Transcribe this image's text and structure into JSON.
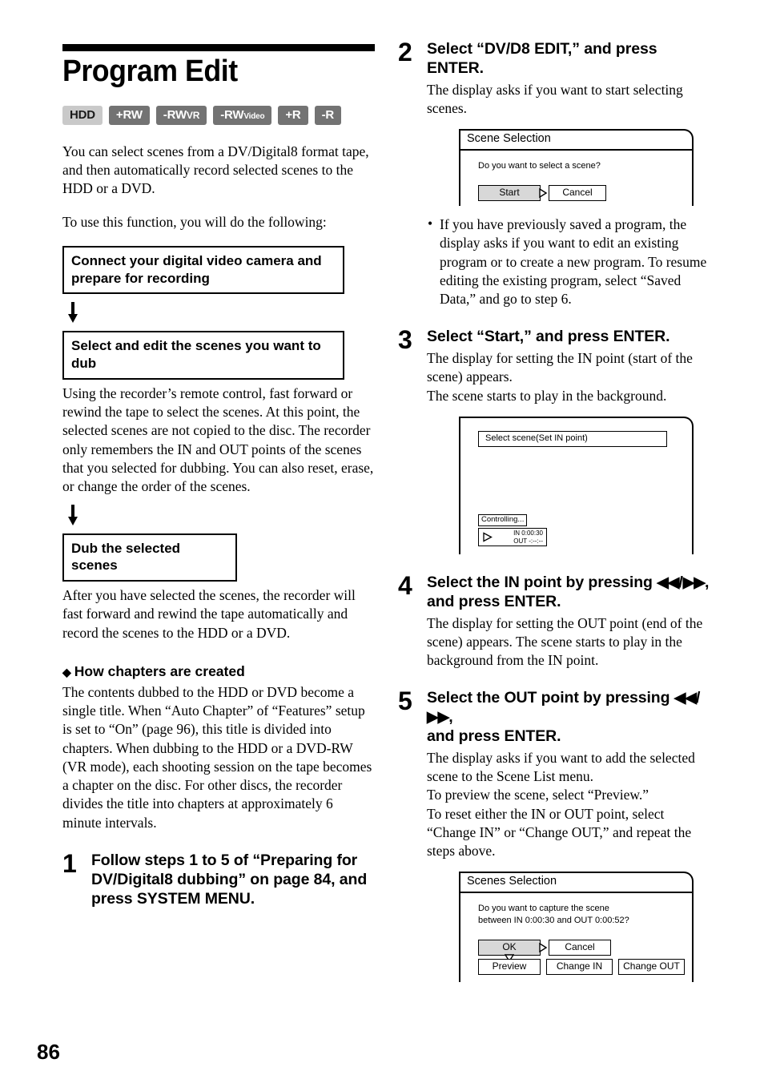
{
  "page": {
    "number": "86"
  },
  "heading": {
    "title": "Program Edit"
  },
  "badges": [
    {
      "label": "HDD",
      "style": "light"
    },
    {
      "label": "+RW",
      "style": "dark"
    },
    {
      "label": "-RWVR",
      "style": "dark"
    },
    {
      "label": "-RWVideo",
      "style": "dark"
    },
    {
      "label": "+R",
      "style": "dark"
    },
    {
      "label": "-R",
      "style": "dark"
    }
  ],
  "intro": {
    "para1": "You can select scenes from a DV/Digital8 format tape, and then automatically record selected scenes to the HDD or a DVD.",
    "para2": "To use this function, you will do the following:"
  },
  "flow": {
    "box1": "Connect your digital video camera and prepare for recording",
    "box2": "Select and edit the scenes you want to dub",
    "box2_text": "Using the recorder’s remote control, fast forward or rewind the tape to select the scenes. At this point, the selected scenes are not copied to the disc. The recorder only remembers the IN and OUT points of the scenes that you selected for dubbing. You can also reset, erase, or change the order of the scenes.",
    "box3": "Dub the selected scenes",
    "box3_text": "After you have selected the scenes, the recorder will fast forward and rewind the tape automatically and record the scenes to the HDD or a DVD.",
    "arrow_icon": "down-arrow-icon"
  },
  "chapters": {
    "bullet_icon": "diamond-bullet-icon",
    "heading": "How chapters are created",
    "text": "The contents dubbed to the HDD or DVD become a single title. When “Auto Chapter” of “Features” setup is set to “On” (page 96), this title is divided into chapters. When dubbing to the HDD or a DVD-RW (VR mode), each shooting session on the tape becomes a chapter on the disc. For other discs, the recorder divides the title into chapters at approximately 6 minute intervals."
  },
  "steps": {
    "step1": {
      "num": "1",
      "heading": "Follow steps 1 to 5 of “Preparing for DV/Digital8 dubbing” on page 84, and press SYSTEM MENU."
    },
    "step2": {
      "num": "2",
      "heading": "Select “DV/D8 EDIT,” and press ENTER.",
      "desc": "The display asks if you want to start selecting scenes.",
      "note": "If you have previously saved a program, the display asks if you want to edit an existing program or to create a new program. To resume editing the existing program, select “Saved Data,” and go to step 6."
    },
    "step3": {
      "num": "3",
      "heading": "Select “Start,” and press ENTER.",
      "desc": "The display for setting the IN point (start of the scene) appears.\nThe scene starts to play in the background."
    },
    "step4": {
      "num": "4",
      "heading_pre": "Select the IN point by pressing ",
      "heading_rew": "◀◀",
      "heading_sep": "/",
      "heading_ff": "▶▶",
      "heading_post": ",",
      "heading_line2": "and press ENTER.",
      "desc": "The display for setting the OUT point (end of the scene) appears. The scene starts to play in the background from the IN point."
    },
    "step5": {
      "num": "5",
      "heading_pre": "Select the OUT point by pressing ",
      "heading_rew": "◀◀",
      "heading_sep": "/",
      "heading_ff": "▶▶",
      "heading_post": ",",
      "heading_line2": "and press ENTER.",
      "desc": "The display asks if you want to add the selected scene to the Scene List menu.\nTo preview the scene, select “Preview.”\nTo reset either the IN or OUT point, select “Change IN” or “Change OUT,” and repeat the steps above."
    }
  },
  "dialogs": {
    "scene_selection": {
      "title": "Scene Selection",
      "message": "Do you want to select a scene?",
      "start_button": "Start",
      "cancel_button": "Cancel",
      "cursor_icon": "cursor-right-icon"
    },
    "set_in_point": {
      "field": "Select scene(Set IN point)",
      "status_chip": "Controlling...",
      "play_icon": "play-triangle-icon",
      "in_label": "IN",
      "in_time": "0:00:30",
      "out_label": "OUT",
      "out_time": "-:--:--"
    },
    "scenes_selection": {
      "title": "Scenes Selection",
      "message_line1": "Do you want to capture the scene",
      "message_line2": "between IN 0:00:30 and OUT 0:00:52?",
      "ok_button": "OK",
      "cancel_button": "Cancel",
      "preview_button": "Preview",
      "change_in_button": "Change IN",
      "change_out_button": "Change OUT",
      "cursor_right_icon": "cursor-right-icon",
      "cursor_down_icon": "cursor-down-icon"
    }
  }
}
